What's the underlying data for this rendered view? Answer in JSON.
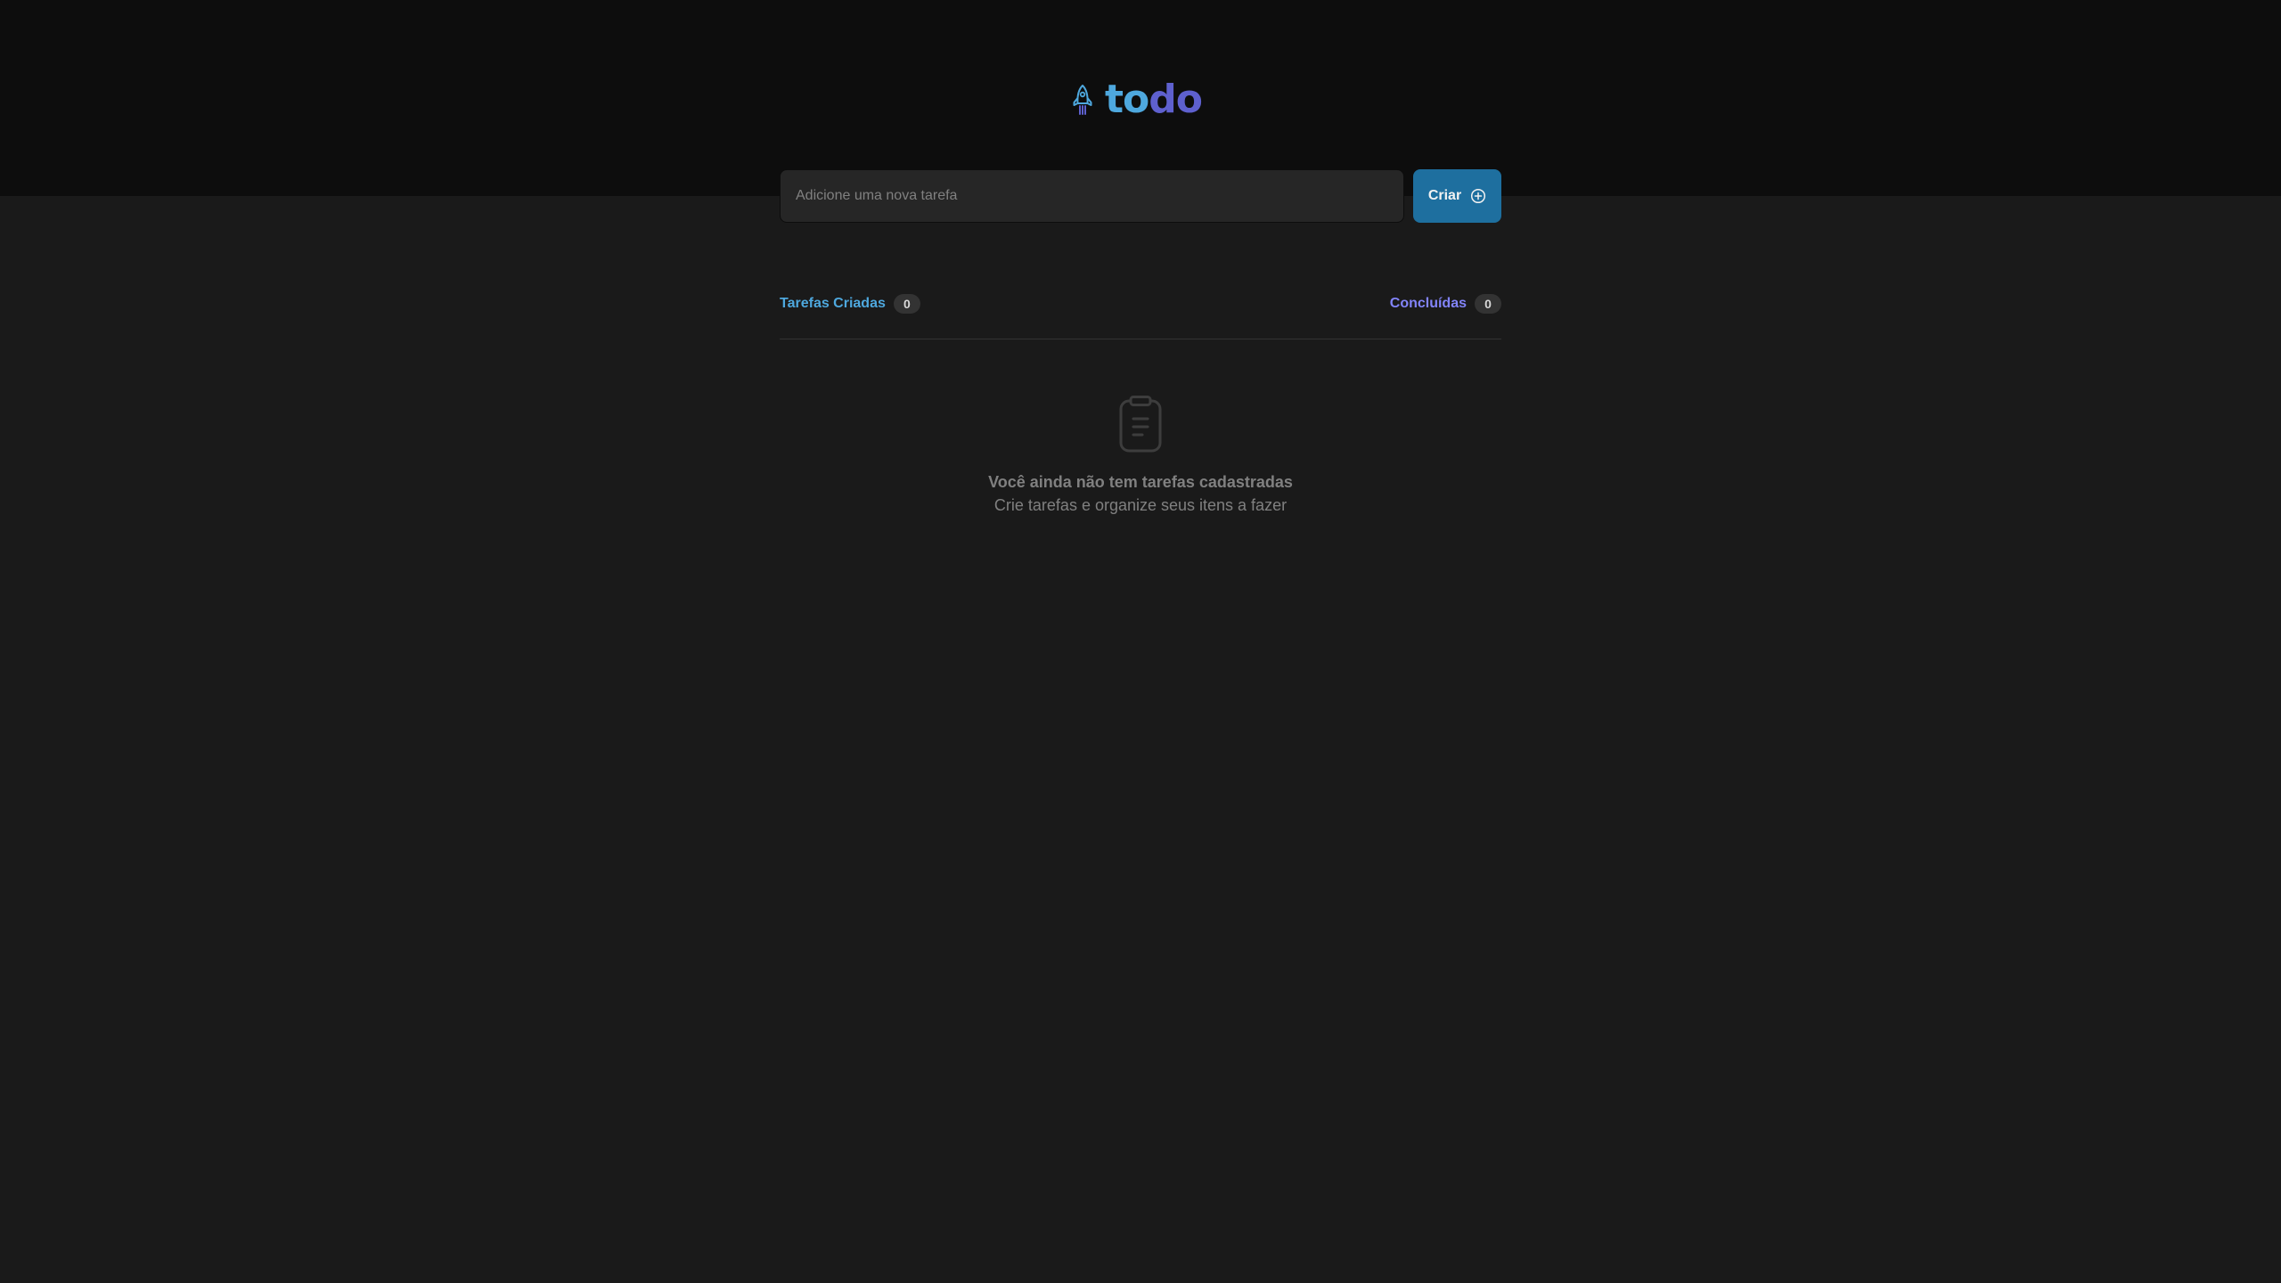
{
  "header": {
    "logo_icon": "rocket-icon",
    "logo_part_1": "to",
    "logo_part_2": "do",
    "colors": {
      "logo_to": "#4ea8de",
      "logo_do": "#5e60ce",
      "background": "#0d0d0d"
    }
  },
  "new_task": {
    "placeholder": "Adicione uma nova tarefa",
    "value": "",
    "create_label": "Criar",
    "create_icon": "plus-circle-icon",
    "button_color": "#1e6f9f"
  },
  "counters": {
    "created": {
      "label": "Tarefas Criadas",
      "count": "0",
      "color": "#4ea8de"
    },
    "done": {
      "label": "Concluídas",
      "count": "0",
      "color": "#8284fa"
    }
  },
  "empty_state": {
    "icon": "clipboard-icon",
    "title": "Você ainda não tem tarefas cadastradas",
    "subtitle": "Crie tarefas e organize seus itens a fazer"
  }
}
